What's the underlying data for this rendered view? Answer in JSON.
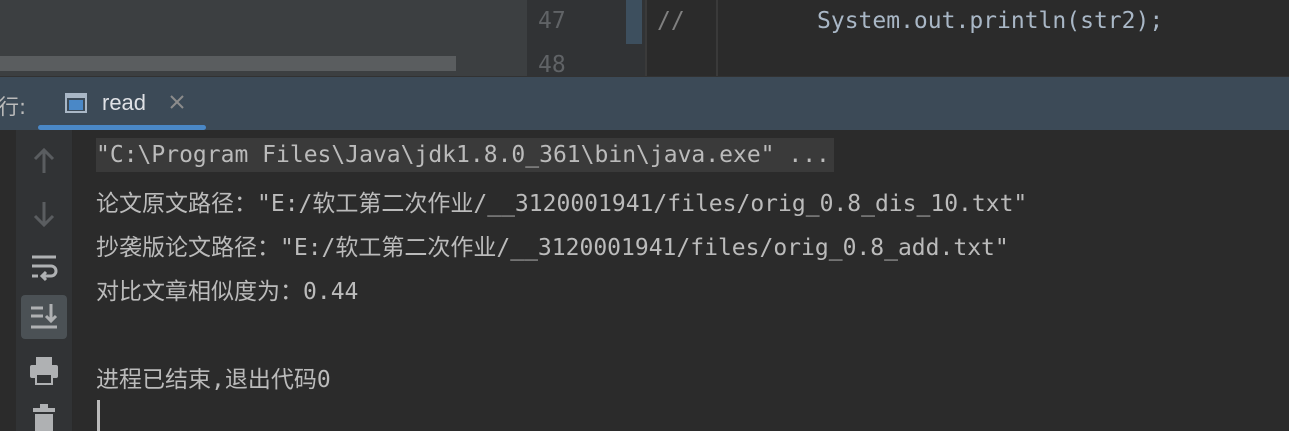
{
  "editor": {
    "line_numbers": [
      "47",
      "48"
    ],
    "comment": "//",
    "code": "System.out.println(str2);"
  },
  "run_window": {
    "title": "行:",
    "tab": {
      "label": "read",
      "icon": "console-window-icon",
      "close_icon": "close-icon"
    }
  },
  "toolbar": {
    "buttons": [
      {
        "name": "rerun-up-arrow-icon"
      },
      {
        "name": "down-arrow-icon"
      },
      {
        "name": "soft-wrap-icon"
      },
      {
        "name": "scroll-to-end-icon",
        "active": true
      },
      {
        "name": "print-icon"
      },
      {
        "name": "trash-icon"
      }
    ]
  },
  "console": {
    "command": "\"C:\\Program Files\\Java\\jdk1.8.0_361\\bin\\java.exe\" ...",
    "lines": [
      "论文原文路径：\"E:/软工第二次作业/__3120001941/files/orig_0.8_dis_10.txt\"",
      "抄袭版论文路径：\"E:/软工第二次作业/__3120001941/files/orig_0.8_add.txt\"",
      "对比文章相似度为：0.44"
    ],
    "exit_message": "进程已结束,退出代码0"
  },
  "colors": {
    "tabbar_bg": "#3c4a57",
    "accent": "#4a88c7",
    "console_bg": "#2b2b2b",
    "text": "#bbbbbb"
  }
}
